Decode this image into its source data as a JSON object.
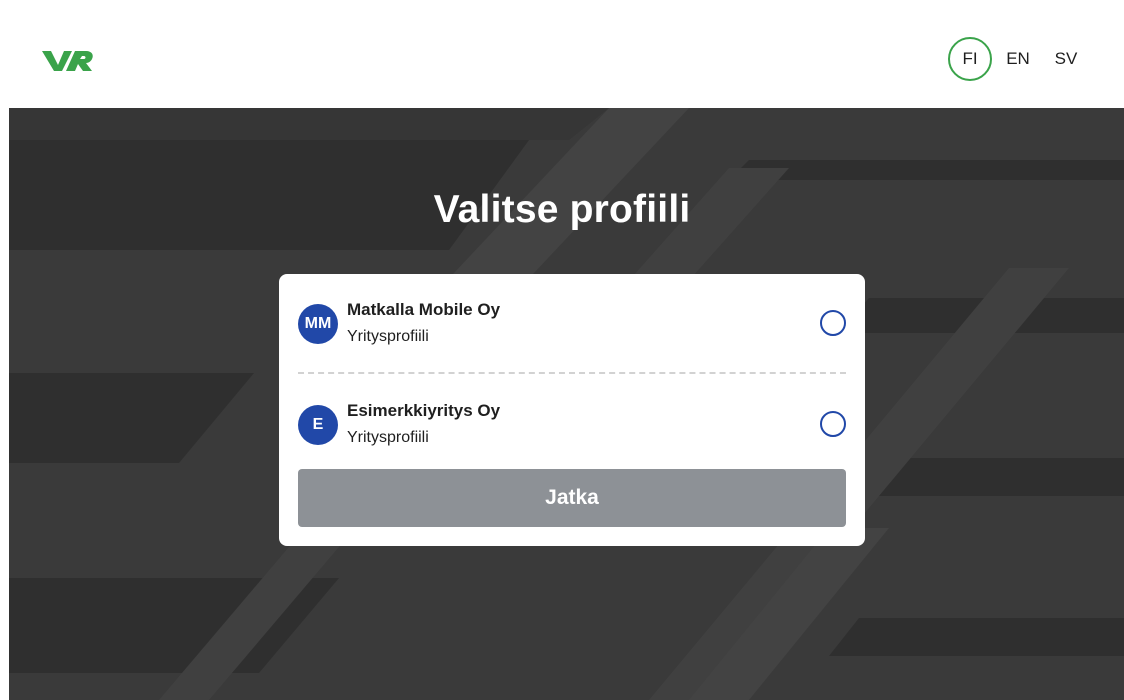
{
  "header": {
    "logo_text": "VR",
    "brand_color": "#3aa34a",
    "languages": [
      {
        "code": "FI",
        "active": true
      },
      {
        "code": "EN",
        "active": false
      },
      {
        "code": "SV",
        "active": false
      }
    ]
  },
  "main": {
    "title": "Valitse profiili",
    "profiles": [
      {
        "initials": "MM",
        "name": "Matkalla Mobile Oy",
        "type": "Yritysprofiili",
        "selected": false
      },
      {
        "initials": "E",
        "name": "Esimerkkiyritys Oy",
        "type": "Yritysprofiili",
        "selected": false
      }
    ],
    "continue_label": "Jatka",
    "continue_disabled": true
  },
  "colors": {
    "accent": "#2148a8",
    "background_dark": "#3a3a3a",
    "button_disabled": "#8d9196"
  }
}
